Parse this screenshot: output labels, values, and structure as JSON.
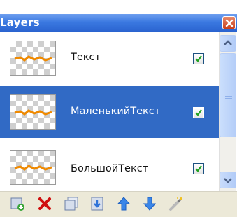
{
  "window": {
    "title": "Layers"
  },
  "layers": [
    {
      "name": "Текст",
      "visible": true,
      "selected": false
    },
    {
      "name": "МаленькийТекст",
      "visible": true,
      "selected": true
    },
    {
      "name": "БольшойТекст",
      "visible": true,
      "selected": false
    }
  ],
  "colors": {
    "titlebar": "#3a78e0",
    "selection": "#316ac5",
    "toolbar": "#ece9d8"
  },
  "toolbar": {
    "buttons": [
      "add-layer-icon",
      "delete-layer-icon",
      "duplicate-layer-icon",
      "merge-layer-down-icon",
      "move-layer-up-icon",
      "move-layer-down-icon",
      "layer-properties-icon"
    ]
  }
}
